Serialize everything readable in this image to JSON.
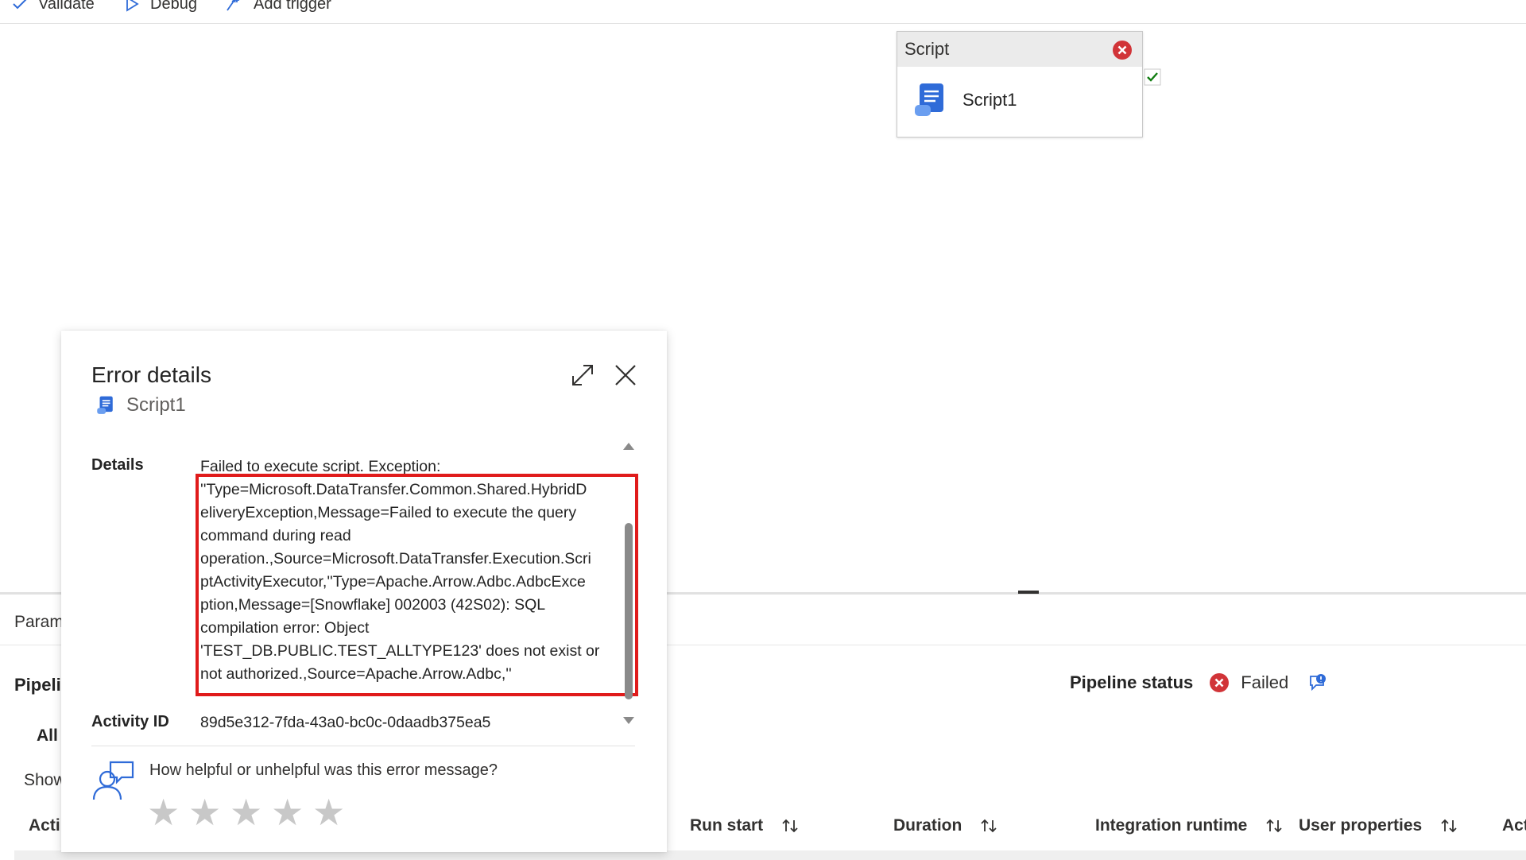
{
  "toolbar": {
    "validate_label": "Validate",
    "debug_label": "Debug",
    "add_trigger_label": "Add trigger"
  },
  "canvas": {
    "activity": {
      "type_label": "Script",
      "name": "Script1"
    }
  },
  "bottom_panel": {
    "tab_label": "Param",
    "pipeline_title": "Pipeli",
    "filter_all_label": "All",
    "show_label": "Show",
    "status": {
      "label": "Pipeline status",
      "value": "Failed"
    },
    "columns": [
      "Acti",
      "Run start",
      "Duration",
      "Integration runtime",
      "User properties",
      "Act"
    ]
  },
  "dialog": {
    "title": "Error details",
    "activity_name": "Script1",
    "details_label": "Details",
    "details_text": "Failed to execute script. Exception:\n''Type=Microsoft.DataTransfer.Common.Shared.HybridD\neliveryException,Message=Failed to execute the query\ncommand during read\noperation.,Source=Microsoft.DataTransfer.Execution.Scri\nptActivityExecutor,''Type=Apache.Arrow.Adbc.AdbcExce\nption,Message=[Snowflake] 002003 (42S02): SQL\ncompilation error: Object\n'TEST_DB.PUBLIC.TEST_ALLTYPE123' does not exist or\nnot authorized.,Source=Apache.Arrow.Adbc,''",
    "activity_id_label": "Activity ID",
    "activity_id_value": "89d5e312-7fda-43a0-bc0c-0daadb375ea5",
    "feedback_question": "How helpful or unhelpful was this error message?",
    "rating_stars": 5
  },
  "colors": {
    "error_red": "#d13438",
    "highlight_red": "#e01b1b",
    "success_green": "#107c10",
    "brand_blue": "#2f6bd8"
  },
  "icons": {
    "validate": "check-icon",
    "debug": "play-icon",
    "add_trigger": "trigger-icon",
    "activity": "script-icon",
    "error": "error-circle-icon",
    "expand": "expand-icon",
    "close": "close-icon",
    "feedback": "feedback-person-icon",
    "sort": "sort-icon"
  }
}
